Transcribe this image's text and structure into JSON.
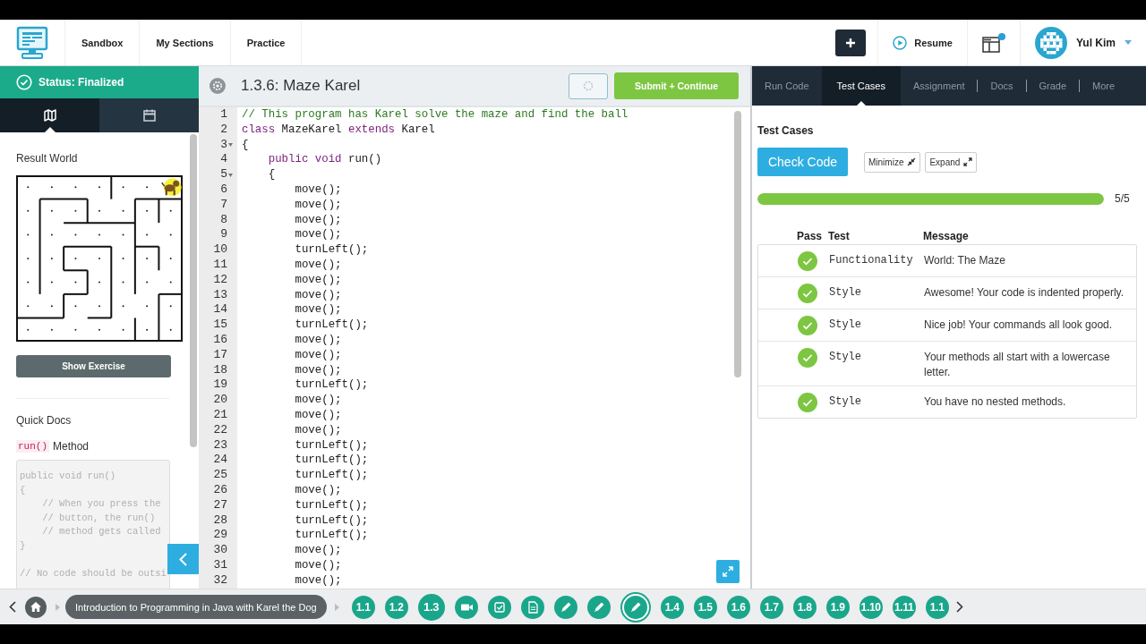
{
  "header": {
    "nav_links": [
      "Sandbox",
      "My Sections",
      "Practice"
    ],
    "resume": "Resume",
    "notification": true,
    "user_name": "Yul Kim"
  },
  "left_panel": {
    "status": "Status: Finalized",
    "tabs": [
      {
        "kind": "map",
        "selected": true
      },
      {
        "kind": "calendar",
        "selected": false
      }
    ],
    "world_title": "Result World",
    "show_exercise": "Show Exercise",
    "quick_docs_title": "Quick Docs",
    "method_name": "run()",
    "method_label": "Method",
    "doc_code": "public void run()\n{\n    // When you press the\n    // button, the run()\n    // method gets called\n}\n\n// No code should be outsi"
  },
  "editor": {
    "title": "1.3.6: Maze Karel",
    "loading": true,
    "submit": "Submit + Continue",
    "lines": [
      {
        "number": "1",
        "foldable": false,
        "tokens": [
          {
            "kind": "comment",
            "text": "// This program has Karel solve the maze and find the ball"
          }
        ]
      },
      {
        "number": "2",
        "foldable": false,
        "tokens": [
          {
            "kind": "keyword",
            "text": "class"
          },
          {
            "kind": "plain",
            "text": " MazeKarel "
          },
          {
            "kind": "keyword",
            "text": "extends"
          },
          {
            "kind": "plain",
            "text": " Karel"
          }
        ]
      },
      {
        "number": "3",
        "foldable": true,
        "tokens": [
          {
            "kind": "plain",
            "text": "{"
          }
        ]
      },
      {
        "number": "4",
        "foldable": false,
        "tokens": [
          {
            "kind": "keyword",
            "text": "    public void"
          },
          {
            "kind": "plain",
            "text": " run()"
          }
        ]
      },
      {
        "number": "5",
        "foldable": true,
        "tokens": [
          {
            "kind": "plain",
            "text": "    {"
          }
        ]
      },
      {
        "number": "6",
        "foldable": false,
        "tokens": [
          {
            "kind": "plain",
            "text": "        move();"
          }
        ]
      },
      {
        "number": "7",
        "foldable": false,
        "tokens": [
          {
            "kind": "plain",
            "text": "        move();"
          }
        ]
      },
      {
        "number": "8",
        "foldable": false,
        "tokens": [
          {
            "kind": "plain",
            "text": "        move();"
          }
        ]
      },
      {
        "number": "9",
        "foldable": false,
        "tokens": [
          {
            "kind": "plain",
            "text": "        move();"
          }
        ]
      },
      {
        "number": "10",
        "foldable": false,
        "tokens": [
          {
            "kind": "plain",
            "text": "        turnLeft();"
          }
        ]
      },
      {
        "number": "11",
        "foldable": false,
        "tokens": [
          {
            "kind": "plain",
            "text": "        move();"
          }
        ]
      },
      {
        "number": "12",
        "foldable": false,
        "tokens": [
          {
            "kind": "plain",
            "text": "        move();"
          }
        ]
      },
      {
        "number": "13",
        "foldable": false,
        "tokens": [
          {
            "kind": "plain",
            "text": "        move();"
          }
        ]
      },
      {
        "number": "14",
        "foldable": false,
        "tokens": [
          {
            "kind": "plain",
            "text": "        move();"
          }
        ]
      },
      {
        "number": "15",
        "foldable": false,
        "tokens": [
          {
            "kind": "plain",
            "text": "        turnLeft();"
          }
        ]
      },
      {
        "number": "16",
        "foldable": false,
        "tokens": [
          {
            "kind": "plain",
            "text": "        move();"
          }
        ]
      },
      {
        "number": "17",
        "foldable": false,
        "tokens": [
          {
            "kind": "plain",
            "text": "        move();"
          }
        ]
      },
      {
        "number": "18",
        "foldable": false,
        "tokens": [
          {
            "kind": "plain",
            "text": "        move();"
          }
        ]
      },
      {
        "number": "19",
        "foldable": false,
        "tokens": [
          {
            "kind": "plain",
            "text": "        turnLeft();"
          }
        ]
      },
      {
        "number": "20",
        "foldable": false,
        "tokens": [
          {
            "kind": "plain",
            "text": "        move();"
          }
        ]
      },
      {
        "number": "21",
        "foldable": false,
        "tokens": [
          {
            "kind": "plain",
            "text": "        move();"
          }
        ]
      },
      {
        "number": "22",
        "foldable": false,
        "tokens": [
          {
            "kind": "plain",
            "text": "        move();"
          }
        ]
      },
      {
        "number": "23",
        "foldable": false,
        "tokens": [
          {
            "kind": "plain",
            "text": "        turnLeft();"
          }
        ]
      },
      {
        "number": "24",
        "foldable": false,
        "tokens": [
          {
            "kind": "plain",
            "text": "        turnLeft();"
          }
        ]
      },
      {
        "number": "25",
        "foldable": false,
        "tokens": [
          {
            "kind": "plain",
            "text": "        turnLeft();"
          }
        ]
      },
      {
        "number": "26",
        "foldable": false,
        "tokens": [
          {
            "kind": "plain",
            "text": "        move();"
          }
        ]
      },
      {
        "number": "27",
        "foldable": false,
        "tokens": [
          {
            "kind": "plain",
            "text": "        turnLeft();"
          }
        ]
      },
      {
        "number": "28",
        "foldable": false,
        "tokens": [
          {
            "kind": "plain",
            "text": "        turnLeft();"
          }
        ]
      },
      {
        "number": "29",
        "foldable": false,
        "tokens": [
          {
            "kind": "plain",
            "text": "        turnLeft();"
          }
        ]
      },
      {
        "number": "30",
        "foldable": false,
        "tokens": [
          {
            "kind": "plain",
            "text": "        move();"
          }
        ]
      },
      {
        "number": "31",
        "foldable": false,
        "tokens": [
          {
            "kind": "plain",
            "text": "        move();"
          }
        ]
      },
      {
        "number": "32",
        "foldable": false,
        "tokens": [
          {
            "kind": "plain",
            "text": "        move();"
          }
        ]
      }
    ]
  },
  "right_panel": {
    "tabs": [
      {
        "label": "Run Code",
        "selected": false
      },
      {
        "label": "Test Cases",
        "selected": true
      },
      {
        "label": "Assignment",
        "selected": false
      },
      {
        "label": "Docs",
        "selected": false
      },
      {
        "label": "Grade",
        "selected": false
      },
      {
        "label": "More",
        "selected": false
      }
    ],
    "title": "Test Cases",
    "check_code": "Check Code",
    "minimize": "Minimize",
    "expand": "Expand",
    "progress": {
      "level": 1,
      "reading": "5/5"
    },
    "columns": [
      "Pass",
      "Test",
      "Message"
    ],
    "rows": [
      {
        "passed": true,
        "test": "Functionality",
        "message": "World: The Maze"
      },
      {
        "passed": true,
        "test": "Style",
        "message": "Awesome! Your code is indented properly."
      },
      {
        "passed": true,
        "test": "Style",
        "message": "Nice job! Your commands all look good."
      },
      {
        "passed": true,
        "test": "Style",
        "message": "Your methods all start with a lowercase letter."
      },
      {
        "passed": true,
        "test": "Style",
        "message": "You have no nested methods."
      }
    ]
  },
  "bottom_nav": {
    "breadcrumb": "Introduction to Programming in Java with Karel the Dog",
    "items": [
      {
        "kind": "lesson",
        "label": "1.1",
        "expanded": false,
        "current": false
      },
      {
        "kind": "lesson",
        "label": "1.2",
        "expanded": false,
        "current": false
      },
      {
        "kind": "lesson",
        "label": "1.3",
        "expanded": true,
        "current": false
      },
      {
        "kind": "video",
        "expanded": false,
        "current": false
      },
      {
        "kind": "quiz",
        "expanded": false,
        "current": false
      },
      {
        "kind": "reading",
        "expanded": false,
        "current": false
      },
      {
        "kind": "exercise",
        "expanded": false,
        "current": false
      },
      {
        "kind": "exercise",
        "expanded": false,
        "current": false
      },
      {
        "kind": "exercise",
        "expanded": false,
        "current": true
      },
      {
        "kind": "lesson",
        "label": "1.4",
        "expanded": false,
        "current": false
      },
      {
        "kind": "lesson",
        "label": "1.5",
        "expanded": false,
        "current": false
      },
      {
        "kind": "lesson",
        "label": "1.6",
        "expanded": false,
        "current": false
      },
      {
        "kind": "lesson",
        "label": "1.7",
        "expanded": false,
        "current": false
      },
      {
        "kind": "lesson",
        "label": "1.8",
        "expanded": false,
        "current": false
      },
      {
        "kind": "lesson",
        "label": "1.9",
        "expanded": false,
        "current": false
      },
      {
        "kind": "lesson",
        "label": "1.10",
        "expanded": false,
        "current": false
      },
      {
        "kind": "lesson",
        "label": "1.11",
        "expanded": false,
        "current": false
      },
      {
        "kind": "lesson",
        "label": "1.1",
        "expanded": false,
        "current": false
      }
    ]
  }
}
